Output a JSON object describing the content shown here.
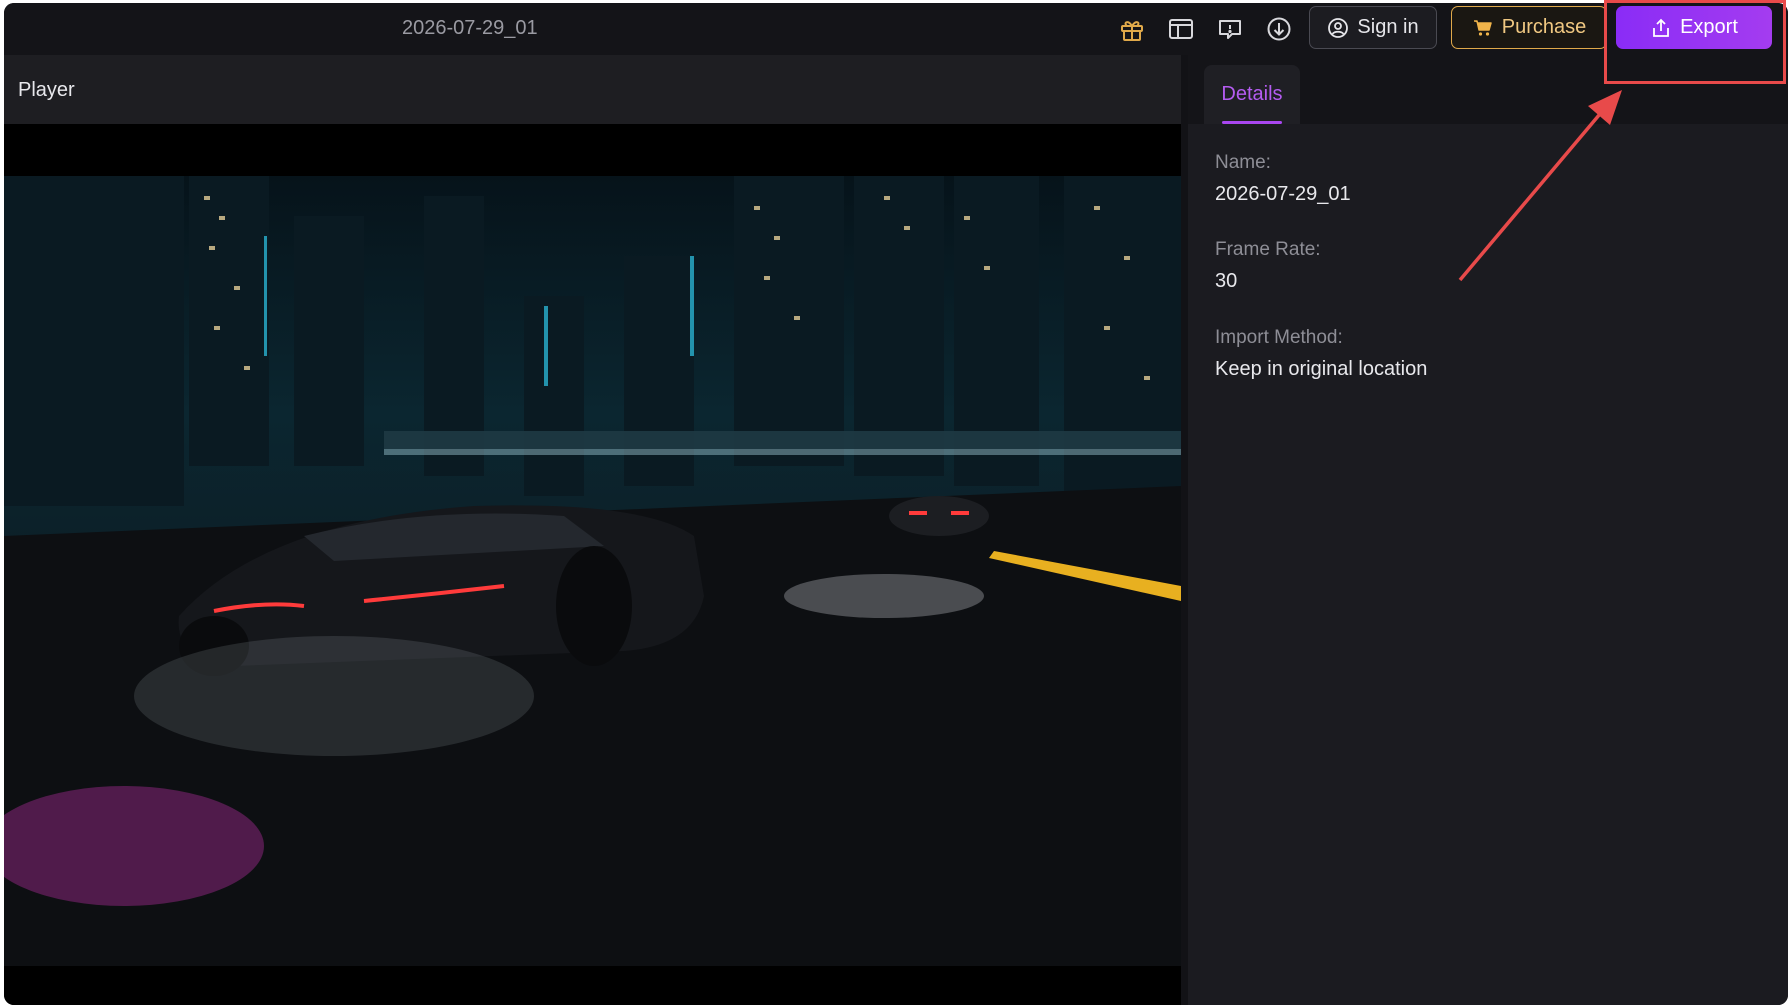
{
  "header": {
    "file_title": "2026-07-29_01",
    "icons": [
      "gift-icon",
      "layout-icon",
      "feedback-icon",
      "download-icon"
    ],
    "signin_label": "Sign in",
    "purchase_label": "Purchase",
    "export_label": "Export"
  },
  "player": {
    "label": "Player"
  },
  "details": {
    "tab_label": "Details",
    "fields": [
      {
        "label": "Name:",
        "value": "2026-07-29_01"
      },
      {
        "label": "Frame Rate:",
        "value": "30"
      },
      {
        "label": "Import Method:",
        "value": "Keep in original location"
      }
    ]
  },
  "colors": {
    "accent": "#a946f0",
    "purchase": "#e0a94a",
    "annotation": "#e84a4a"
  }
}
